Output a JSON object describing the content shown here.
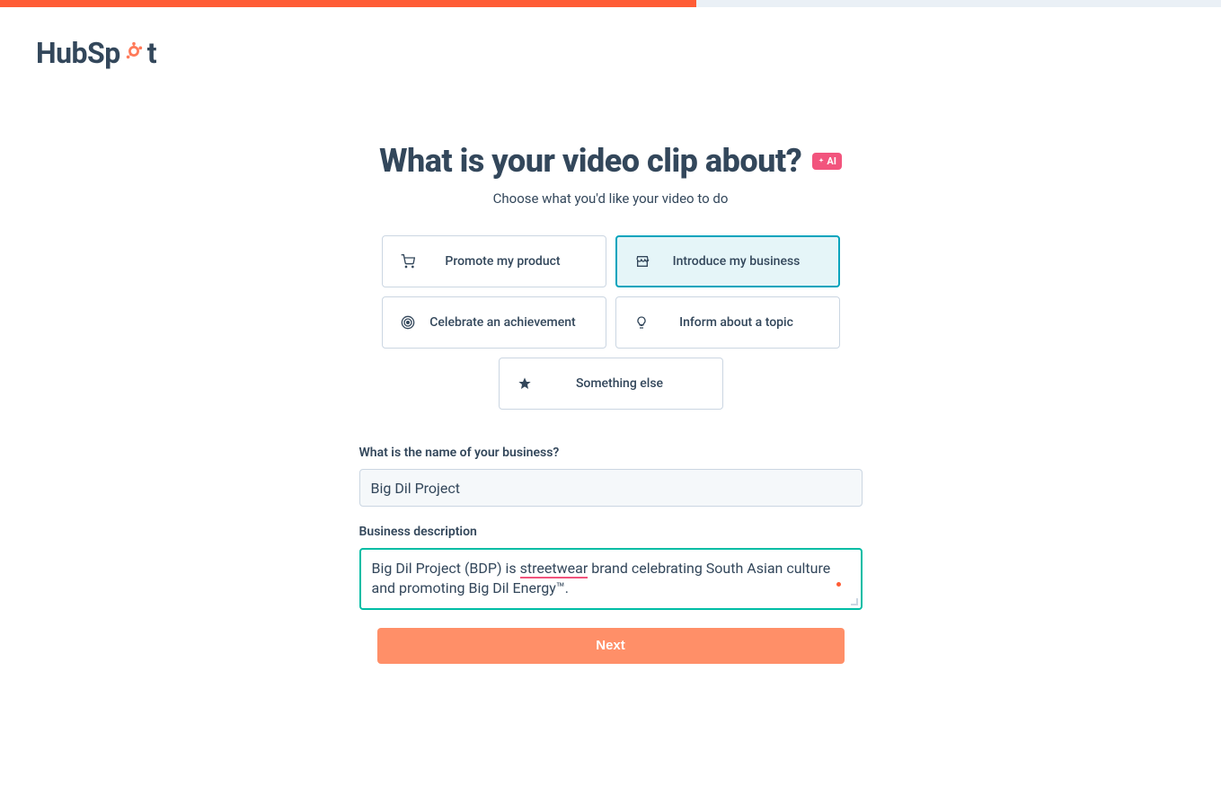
{
  "progress": 57,
  "brand": "HubSpot",
  "heading": "What is your video clip about?",
  "ai_badge": "AI",
  "subheading": "Choose what you'd like your video to do",
  "options": [
    {
      "label": "Promote my product",
      "icon": "cart",
      "selected": false
    },
    {
      "label": "Introduce my business",
      "icon": "storefront",
      "selected": true
    },
    {
      "label": "Celebrate an achievement",
      "icon": "target",
      "selected": false
    },
    {
      "label": "Inform about a topic",
      "icon": "bulb",
      "selected": false
    },
    {
      "label": "Something else",
      "icon": "star",
      "selected": false
    }
  ],
  "form": {
    "business_name_label": "What is the name of your business?",
    "business_name_value": "Big Dil Project",
    "description_label": "Business description",
    "description_prefix": "Big Dil Project (BDP) is ",
    "description_underlined": "streetwear",
    "description_suffix": " brand celebrating South Asian culture and promoting Big Dil Energy™."
  },
  "next_label": "Next"
}
